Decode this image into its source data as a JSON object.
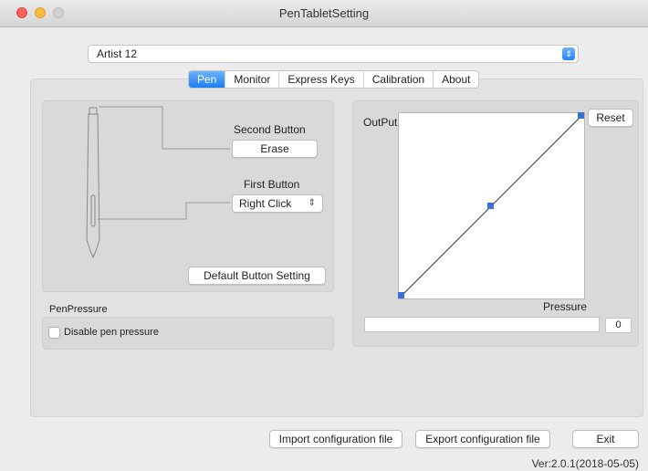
{
  "window": {
    "title": "PenTabletSetting"
  },
  "device": {
    "selected": "Artist 12"
  },
  "tabs": [
    {
      "label": "Pen",
      "active": true
    },
    {
      "label": "Monitor",
      "active": false
    },
    {
      "label": "Express Keys",
      "active": false
    },
    {
      "label": "Calibration",
      "active": false
    },
    {
      "label": "About",
      "active": false
    }
  ],
  "pen": {
    "second_button_label": "Second Button",
    "second_button_value": "Erase",
    "first_button_label": "First Button",
    "first_button_value": "Right Click",
    "default_button": "Default  Button Setting"
  },
  "pen_pressure": {
    "section_label": "PenPressure",
    "disable_label": "Disable pen pressure",
    "disable_checked": false
  },
  "curve": {
    "output_label": "OutPut",
    "pressure_label": "Pressure",
    "reset_button": "Reset",
    "pressure_value": "0",
    "line_color": "#3a3a3a",
    "handle_color": "#3a6fd8"
  },
  "footer": {
    "import_button": "Import configuration file",
    "export_button": "Export configuration file",
    "exit_button": "Exit",
    "version": "Ver:2.0.1(2018-05-05)"
  },
  "colors": {
    "accent": "#1b7cf3",
    "close": "#fc605b",
    "minimize": "#fdbc40"
  }
}
